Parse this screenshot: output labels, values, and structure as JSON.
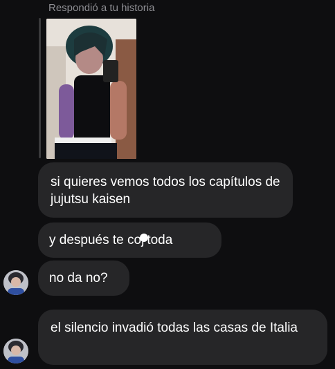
{
  "reply_header": "Respondió a tu historia",
  "story": {
    "image": "mirror-selfie-photo"
  },
  "messages": [
    {
      "text": "si quieres vemos todos los capítulos de jujutsu kaisen"
    },
    {
      "text_before": "y después te coj",
      "text_after": "toda"
    },
    {
      "text": "no da no?"
    },
    {
      "text": "el silencio invadió todas las casas de Italia"
    }
  ],
  "colors": {
    "background": "#0e0e10",
    "bubble": "#262628",
    "meta_text": "#8e8e93"
  }
}
